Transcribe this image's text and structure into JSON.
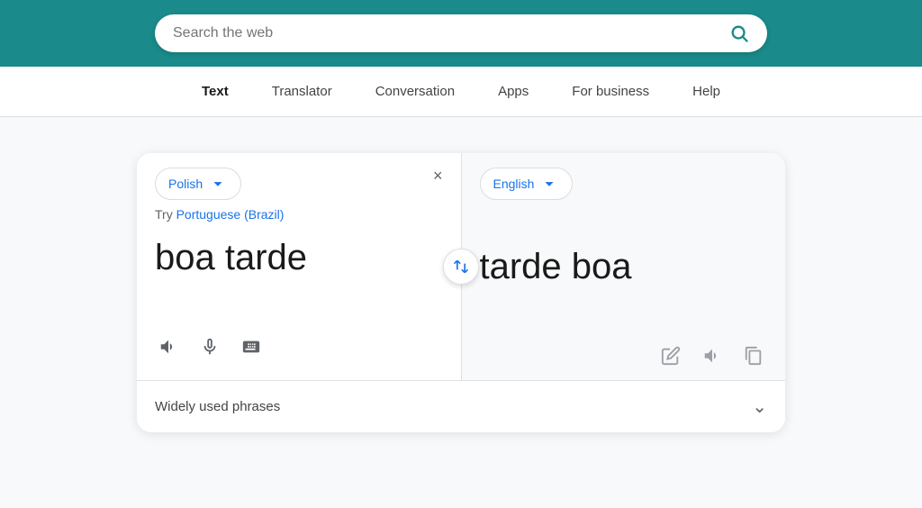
{
  "header": {
    "background_color": "#1a8a8a",
    "search": {
      "placeholder": "Search the web",
      "value": ""
    }
  },
  "nav": {
    "items": [
      {
        "id": "text",
        "label": "Text",
        "active": true
      },
      {
        "id": "translator",
        "label": "Translator",
        "active": false
      },
      {
        "id": "conversation",
        "label": "Conversation",
        "active": false
      },
      {
        "id": "apps",
        "label": "Apps",
        "active": false
      },
      {
        "id": "for-business",
        "label": "For business",
        "active": false
      },
      {
        "id": "help",
        "label": "Help",
        "active": false
      }
    ]
  },
  "translator": {
    "source_lang": "Polish",
    "target_lang": "English",
    "suggestion_prefix": "Try ",
    "suggestion_link": "Portuguese (Brazil)",
    "source_text": "boa tarde",
    "target_text": "tarde boa",
    "clear_label": "×",
    "phrases_label": "Widely used phrases"
  }
}
